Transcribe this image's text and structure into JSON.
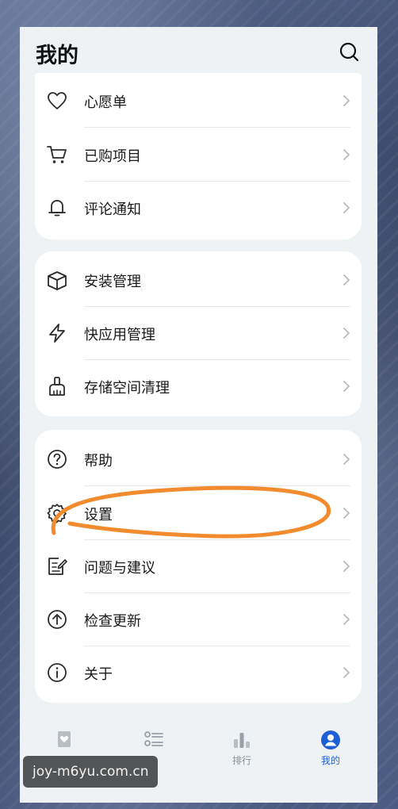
{
  "header": {
    "title": "我的"
  },
  "groups": [
    {
      "items": [
        {
          "label": "心愿单",
          "icon": "heart-icon"
        },
        {
          "label": "已购项目",
          "icon": "cart-icon"
        },
        {
          "label": "评论通知",
          "icon": "bell-icon"
        }
      ]
    },
    {
      "items": [
        {
          "label": "安装管理",
          "icon": "package-box-icon"
        },
        {
          "label": "快应用管理",
          "icon": "lightning-icon"
        },
        {
          "label": "存储空间清理",
          "icon": "broom-icon"
        }
      ]
    },
    {
      "items": [
        {
          "label": "帮助",
          "icon": "question-circle-icon"
        },
        {
          "label": "设置",
          "icon": "gear-icon"
        },
        {
          "label": "问题与建议",
          "icon": "feedback-edit-icon"
        },
        {
          "label": "检查更新",
          "icon": "arrow-up-circle-icon"
        },
        {
          "label": "关于",
          "icon": "info-circle-icon"
        }
      ]
    }
  ],
  "tabbar": {
    "tabs": [
      {
        "label": "",
        "icon": "featured-icon"
      },
      {
        "label": "",
        "icon": "category-list-icon"
      },
      {
        "label": "排行",
        "icon": "ranking-icon"
      },
      {
        "label": "我的",
        "icon": "profile-icon",
        "active": true
      }
    ]
  },
  "watermark": {
    "text": "joy-m6yu.com.cn"
  },
  "colors": {
    "accent": "#1f5fd6",
    "annotation": "#f28a2e",
    "card": "#ffffff",
    "page": "#eef2f5"
  }
}
